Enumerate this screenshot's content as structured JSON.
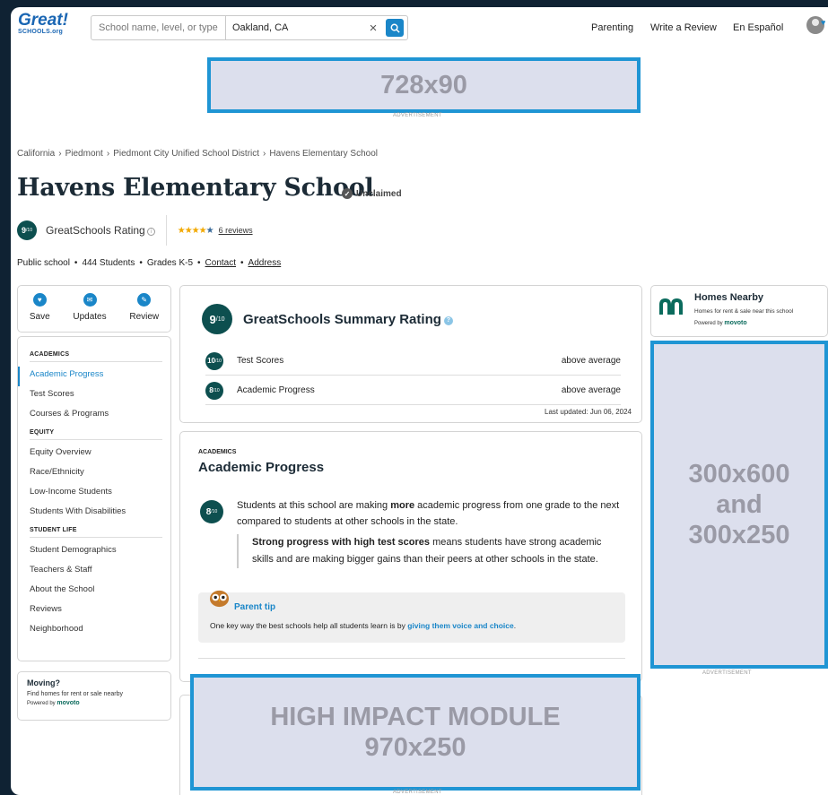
{
  "header": {
    "logo_main": "Great!",
    "logo_sub": "SCHOOLS.org",
    "search_placeholder": "School name, level, or type",
    "location_value": "Oakland, CA",
    "clear_icon": "×",
    "nav": [
      "Parenting",
      "Write a Review",
      "En Español"
    ]
  },
  "ads": {
    "leaderboard": "728x90",
    "leaderboard_caption": "ADVERTISEMENT",
    "sidebar": [
      "300x600",
      "and",
      "300x250"
    ],
    "sidebar_caption": "ADVERTISEMENT",
    "high_impact": [
      "HIGH IMPACT MODULE",
      "970x250"
    ],
    "high_impact_caption": "ADVERTISEMENT"
  },
  "breadcrumbs": [
    "California",
    "Piedmont",
    "Piedmont City Unified School District",
    "Havens Elementary School"
  ],
  "breadcrumb_separator": "›",
  "school": {
    "name": "Havens Elementary School",
    "claim_status": "Unclaimed",
    "rating_value": "9",
    "rating_scale": "/10",
    "rating_label": "GreatSchools Rating",
    "rating_info": "i",
    "stars": 4.5,
    "reviews_link": "6 reviews",
    "facts": {
      "type": "Public school",
      "students": "444 Students",
      "grades": "Grades K-5",
      "contact_link": "Contact",
      "address_link": "Address"
    }
  },
  "actions": [
    {
      "label": "Save",
      "icon": "heart-icon"
    },
    {
      "label": "Updates",
      "icon": "envelope-icon"
    },
    {
      "label": "Review",
      "icon": "pencil-icon"
    }
  ],
  "sidenav": [
    {
      "heading": "ACADEMICS",
      "items": [
        "Academic Progress",
        "Test Scores",
        "Courses & Programs"
      ]
    },
    {
      "heading": "EQUITY",
      "items": [
        "Equity Overview",
        "Race/Ethnicity",
        "Low-Income Students",
        "Students With Disabilities"
      ]
    },
    {
      "heading": "STUDENT LIFE",
      "items": [
        "Student Demographics",
        "Teachers & Staff",
        "About the School",
        "Reviews",
        "Neighborhood"
      ]
    }
  ],
  "sidenav_active": "Academic Progress",
  "moving": {
    "title": "Moving?",
    "subtitle": "Find homes for rent or sale nearby",
    "powered_by": "Powered by",
    "brand": "movoto"
  },
  "summary": {
    "rating_value": "9",
    "rating_scale": "/10",
    "title": "GreatSchools Summary Rating",
    "help_icon": "?",
    "rows": [
      {
        "value": "10",
        "scale": "/10",
        "label": "Test Scores",
        "status": "above average"
      },
      {
        "value": "8",
        "scale": "/10",
        "label": "Academic Progress",
        "status": "above average"
      }
    ],
    "last_updated": "Last updated: Jun 06, 2024"
  },
  "academic_progress": {
    "eyebrow": "ACADEMICS",
    "title": "Academic Progress",
    "rating_value": "8",
    "rating_scale": "/10",
    "text_before": "Students at this school are making ",
    "text_bold": "more",
    "text_after": " academic progress from one grade to the next compared to students at other schools in the state.",
    "quote_bold": "Strong progress with high test scores",
    "quote_rest": " means students have strong academic skills and are making bigger gains than their peers at other schools in the state.",
    "tip_title": "Parent tip",
    "tip_text": "One key way the best schools help all students learn is by ",
    "tip_link": "giving them voice and choice",
    "tip_end": "."
  },
  "homes": {
    "title": "Homes Nearby",
    "subtitle": "Homes for rent & sale near this school",
    "powered_by": "Powered by",
    "brand": "movoto"
  },
  "colors": {
    "brand_blue": "#1a66b3",
    "accent_blue": "#1a86c8",
    "rating_green": "#0d4f4f",
    "ad_border": "#1f95d4",
    "ad_fill": "#dcdfed"
  }
}
